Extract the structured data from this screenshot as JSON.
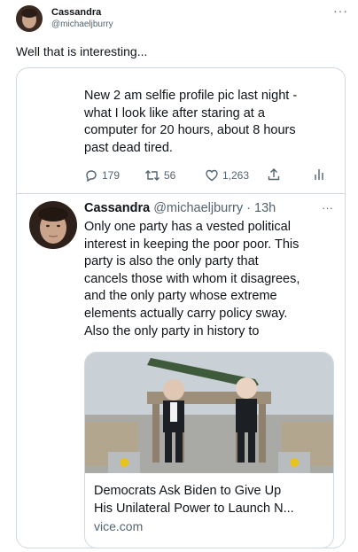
{
  "outer": {
    "name": "Cassandra",
    "handle": "@michaeljburry",
    "more_icon": "more-dots-icon",
    "text": "Well that is interesting..."
  },
  "quoted_top": {
    "text_lines": [
      "New 2 am selfie profile pic last night -",
      "what I look like after staring at a",
      "computer for 20 hours, about 8 hours",
      "past dead tired."
    ],
    "actions": {
      "replies": "179",
      "retweets": "56",
      "likes": "1,263"
    }
  },
  "quoted_reply": {
    "name": "Cassandra",
    "handle_time": "@michaeljburry · 13h",
    "more": "···",
    "text_lines": [
      "Only one party has a vested political",
      "interest in keeping the poor poor.  This",
      "party is also the only party that",
      "cancels those with whom it disagrees,",
      "and the only party whose extreme",
      "elements actually carry policy sway.",
      "Also the only party in history to"
    ],
    "link_card": {
      "title_lines": [
        "Democrats Ask Biden to Give Up",
        "His Unilateral Power to Launch N..."
      ],
      "domain": "vice.com"
    }
  },
  "colors": {
    "text": "#0f1419",
    "muted": "#536471",
    "border": "#cfd9de"
  }
}
